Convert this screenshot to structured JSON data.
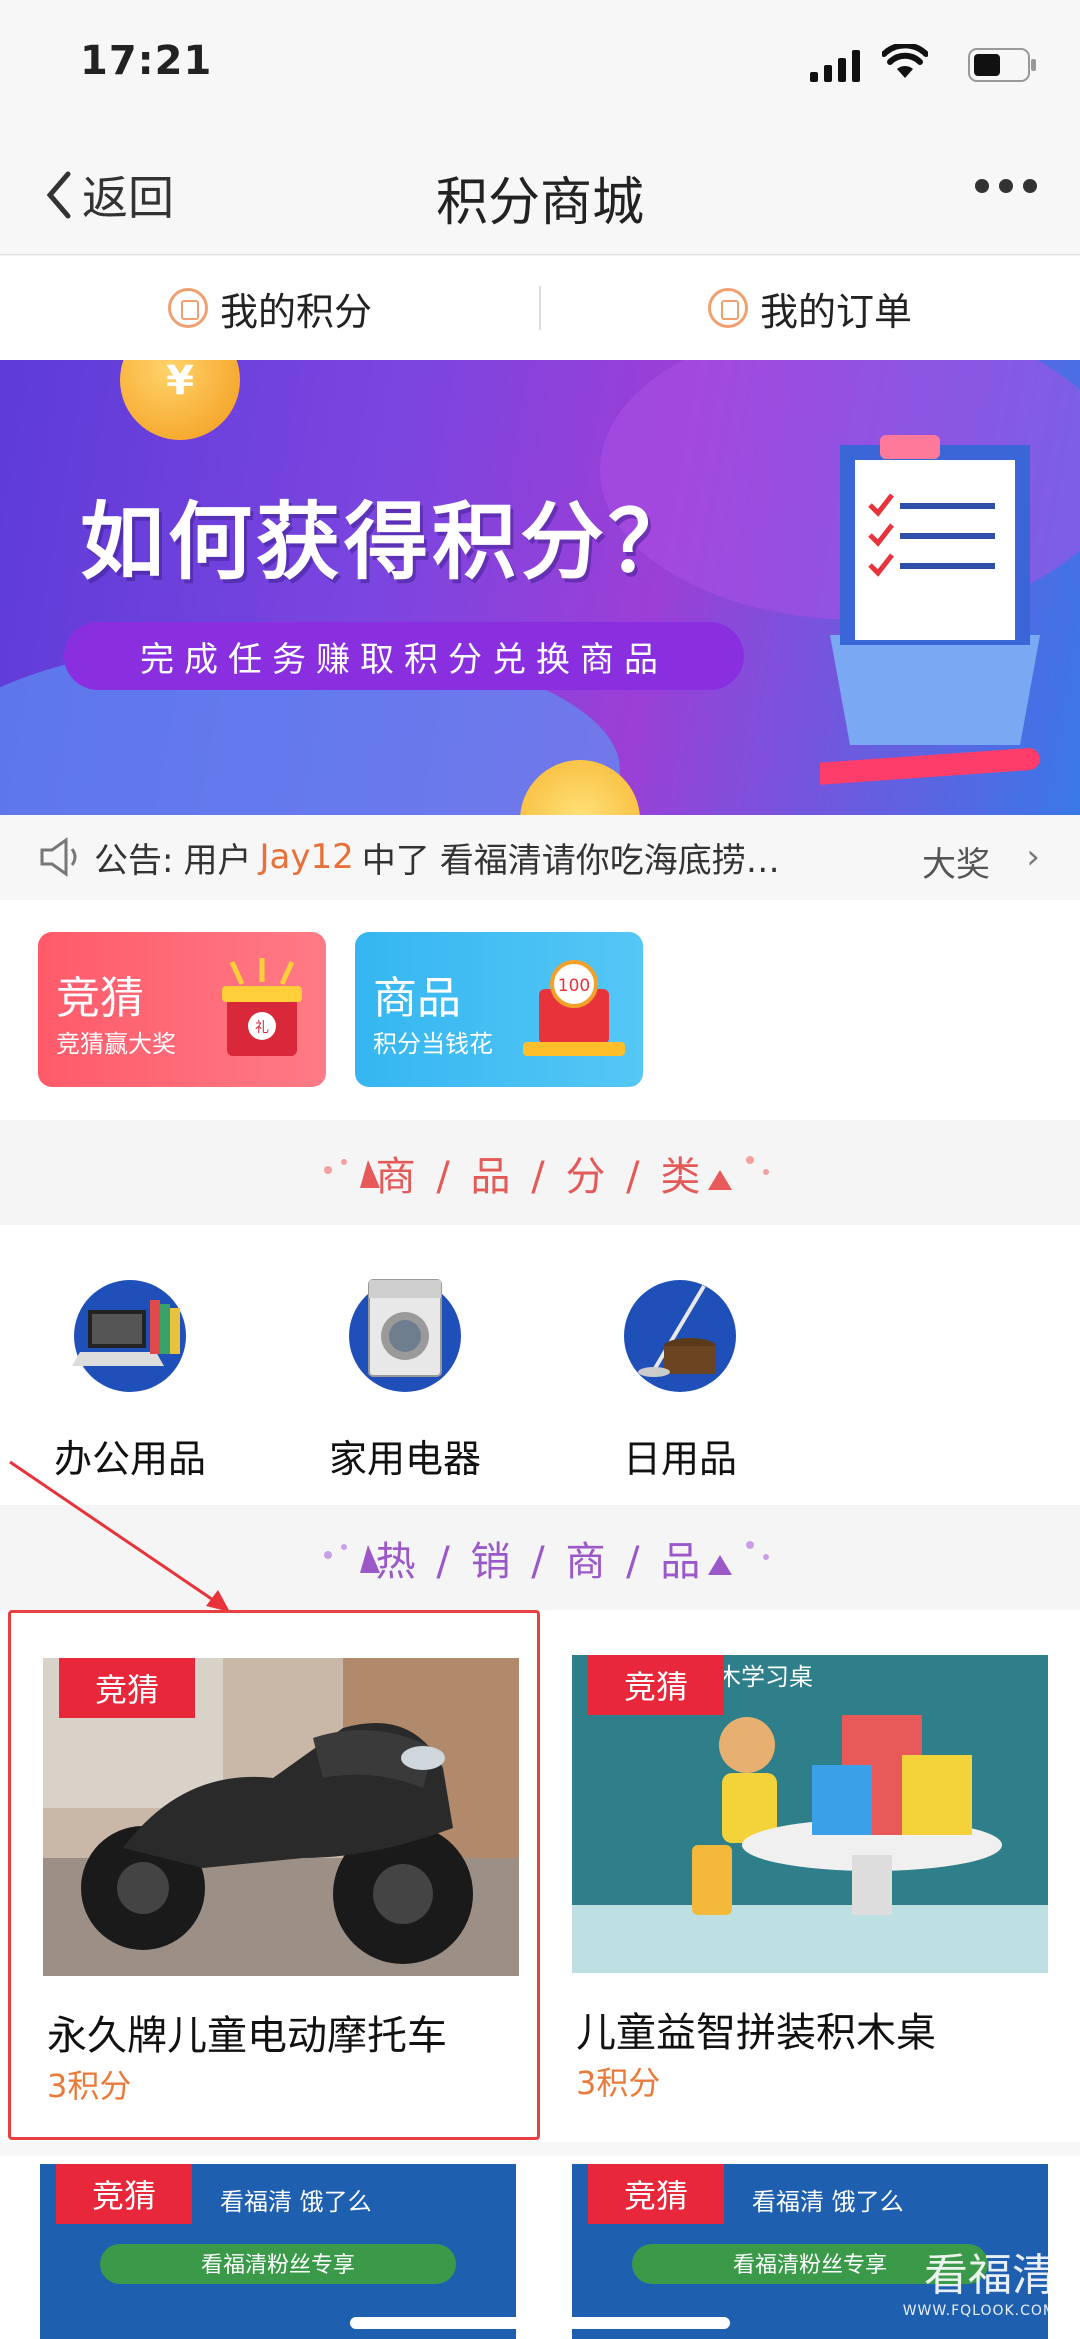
{
  "status": {
    "time": "17:21"
  },
  "nav": {
    "back_label": "返回",
    "title": "积分商城"
  },
  "tabs": [
    {
      "label": "我的积分"
    },
    {
      "label": "我的订单"
    }
  ],
  "banner": {
    "coin_symbol": "¥",
    "headline": "如何获得积分？",
    "subline": "完成任务赚取积分兑换商品"
  },
  "notice": {
    "prefix": "公告:",
    "user_word": "用户",
    "username": "Jay12",
    "middle": "中了",
    "item": "看福清请你吃海底捞…",
    "prize": "大奖",
    "chevron": "›"
  },
  "entries": [
    {
      "title": "竞猜",
      "subtitle": "竞猜赢大奖",
      "art_text": "礼"
    },
    {
      "title": "商品",
      "subtitle": "积分当钱花",
      "art_text": "100"
    }
  ],
  "sections": {
    "categories": "商 / 品 / 分 / 类",
    "hot": "热 / 销 / 商 / 品"
  },
  "categories": [
    {
      "label": "办公用品"
    },
    {
      "label": "家用电器"
    },
    {
      "label": "日用品"
    }
  ],
  "products": [
    {
      "badge": "竞猜",
      "name": "永久牌儿童电动摩托车",
      "points": "3积分",
      "selected": true
    },
    {
      "badge": "竞猜",
      "name": "儿童益智拼装积木桌",
      "points": "3积分",
      "selected": false,
      "img_text": "木学习桌"
    },
    {
      "badge": "竞猜",
      "img_text": "看福清 饿了么",
      "promo": "看福清粉丝专享"
    },
    {
      "badge": "竞猜",
      "img_text": "看福清 饿了么",
      "promo": "看福清粉丝专享"
    }
  ],
  "watermark": {
    "brand": "看福清",
    "url": "WWW.FQLOOK.COM"
  },
  "colors": {
    "accent": "#e8273b",
    "points": "#e87a3a",
    "category_head": "#e35a58",
    "hot_head": "#9a58c8"
  }
}
